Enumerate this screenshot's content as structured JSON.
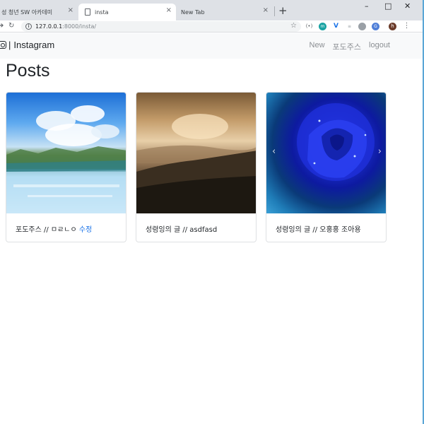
{
  "browser": {
    "tabs": [
      {
        "title": "성 청년 SW 아카데미",
        "active": false
      },
      {
        "title": "insta",
        "active": true
      },
      {
        "title": "New Tab",
        "active": false
      }
    ],
    "tab_close_glyph": "×",
    "new_tab_glyph": "+",
    "window_controls": {
      "minimize": "–",
      "maximize": "□",
      "close": "✕"
    },
    "address": {
      "host": "127.0.0.1",
      "path": ":8000/insta/"
    },
    "toolbar_icons": [
      "back-icon",
      "reload-icon",
      "info-icon",
      "star-icon"
    ],
    "extensions": [
      {
        "name": "extension-icon-1",
        "color": "#5f6368"
      },
      {
        "name": "extension-icon-2",
        "color": "#1aa3a3"
      },
      {
        "name": "extension-icon-3",
        "color": "#1a73e8"
      },
      {
        "name": "extension-icon-4",
        "color": "#9aa0a6"
      },
      {
        "name": "extension-icon-5",
        "color": "#6b6f73"
      },
      {
        "name": "extension-icon-6",
        "color": "#1a73e8"
      },
      {
        "name": "profile-avatar",
        "color": "#6b3b2a",
        "label": "h"
      }
    ]
  },
  "navbar": {
    "brand": "Instagram",
    "brand_separator": "|",
    "links": [
      {
        "label": "New"
      },
      {
        "label": "포도주스"
      },
      {
        "label": "logout"
      }
    ]
  },
  "page_title": "Posts",
  "posts": [
    {
      "caption": "포도주스 // ㅁㄹㄴㅇ ",
      "edit_link": "수정",
      "image": "lake landscape"
    },
    {
      "caption": "성령잉의 글 // asdfasd",
      "image": "sunset over hills"
    },
    {
      "caption": "성령잉의 글 // 오홍홍 조아용",
      "image": "blue rose"
    }
  ],
  "carousel_arrows": {
    "prev": "‹",
    "next": "›"
  },
  "colors": {
    "link": "#1a73e8",
    "navbar_bg": "#f8f9fa",
    "text": "#212529"
  }
}
